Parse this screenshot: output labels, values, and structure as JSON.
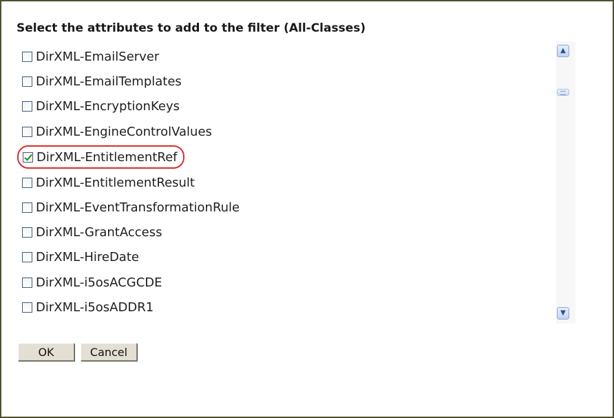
{
  "dialog": {
    "heading": "Select the attributes to add to the filter (All-Classes)"
  },
  "attributes": [
    {
      "label": "DirXML-EmailServer",
      "checked": false
    },
    {
      "label": "DirXML-EmailTemplates",
      "checked": false
    },
    {
      "label": "DirXML-EncryptionKeys",
      "checked": false
    },
    {
      "label": "DirXML-EngineControlValues",
      "checked": false
    },
    {
      "label": "DirXML-EntitlementRef",
      "checked": true
    },
    {
      "label": "DirXML-EntitlementResult",
      "checked": false
    },
    {
      "label": "DirXML-EventTransformationRule",
      "checked": false
    },
    {
      "label": "DirXML-GrantAccess",
      "checked": false
    },
    {
      "label": "DirXML-HireDate",
      "checked": false
    },
    {
      "label": "DirXML-i5osACGCDE",
      "checked": false
    },
    {
      "label": "DirXML-i5osADDR1",
      "checked": false
    }
  ],
  "scrollbar": {
    "up_icon": "chevron-up-icon",
    "down_icon": "chevron-down-icon",
    "thumb_icon": "grip-icon"
  },
  "buttons": {
    "ok_label": "OK",
    "cancel_label": "Cancel"
  },
  "colors": {
    "highlight": "#dd2a2a",
    "check": "#1f8a1f",
    "border": "#4f4f2c"
  }
}
